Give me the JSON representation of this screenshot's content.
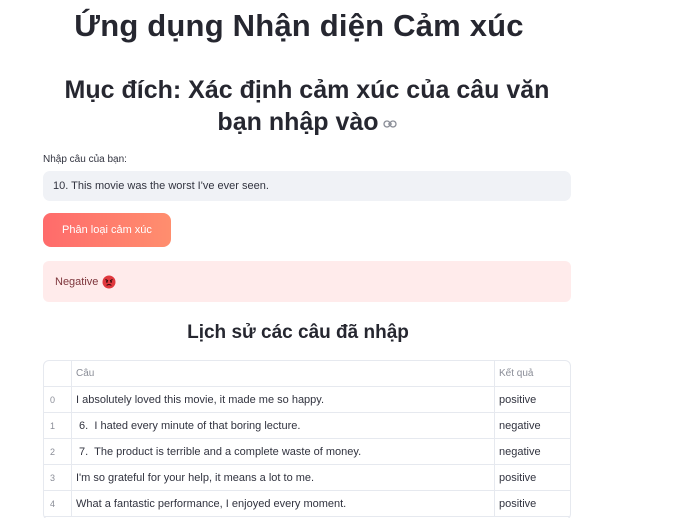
{
  "header": {
    "title": "Ứng dụng Nhận diện Cảm xúc",
    "subtitle": "Mục đích: Xác định cảm xúc của câu văn bạn nhập vào"
  },
  "form": {
    "input_label": "Nhập câu của bạn:",
    "input_value": "10. This movie was the worst I've ever seen.",
    "button_label": "Phân loại cảm xúc"
  },
  "result": {
    "text": "Negative",
    "icon": "angry-face-icon",
    "color": "#ffebeb"
  },
  "history": {
    "title": "Lịch sử các câu đã nhập",
    "columns": [
      "",
      "Câu",
      "Kết quả"
    ],
    "rows": [
      {
        "index": "0",
        "sentence": "I absolutely loved this movie, it made me so happy.",
        "result": "positive"
      },
      {
        "index": "1",
        "sentence": " 6.  I hated every minute of that boring lecture.",
        "result": "negative"
      },
      {
        "index": "2",
        "sentence": " 7.  The product is terrible and a complete waste of money.",
        "result": "negative"
      },
      {
        "index": "3",
        "sentence": "I'm so grateful for your help, it means a lot to me.",
        "result": "positive"
      },
      {
        "index": "4",
        "sentence": "What a fantastic performance, I enjoyed every moment.",
        "result": "positive"
      }
    ]
  },
  "colors": {
    "button_gradient_start": "#ff6b6b",
    "button_gradient_end": "#ff8e6e",
    "result_text": "#7d353b"
  }
}
